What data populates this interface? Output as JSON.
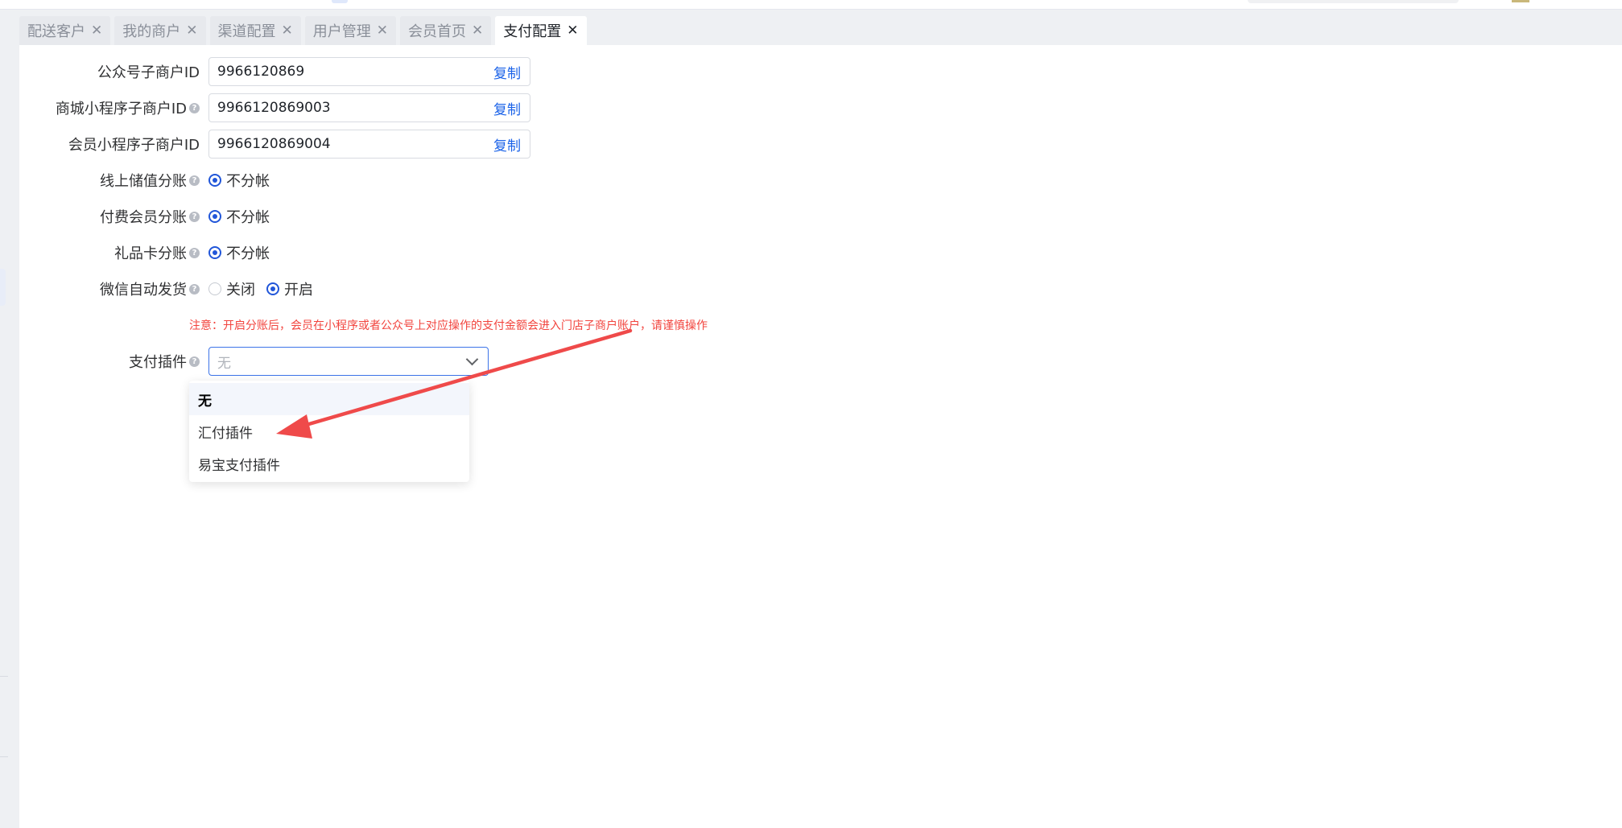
{
  "tabs": [
    {
      "label": "配送客户",
      "close": "✕"
    },
    {
      "label": "我的商户",
      "close": "✕"
    },
    {
      "label": "渠道配置",
      "close": "✕"
    },
    {
      "label": "用户管理",
      "close": "✕"
    },
    {
      "label": "会员首页",
      "close": "✕"
    },
    {
      "label": "支付配置",
      "close": "✕",
      "active": true
    }
  ],
  "form": {
    "official_account_id": {
      "label": "公众号子商户ID",
      "value": "9966120869",
      "copy": "复制"
    },
    "mall_miniprogram_id": {
      "label": "商城小程序子商户ID",
      "value": "9966120869003",
      "copy": "复制"
    },
    "member_miniprogram_id": {
      "label": "会员小程序子商户ID",
      "value": "9966120869004",
      "copy": "复制"
    },
    "online_stored_value_split": {
      "label": "线上储值分账",
      "option": "不分帐"
    },
    "paid_member_split": {
      "label": "付费会员分账",
      "option": "不分帐"
    },
    "gift_card_split": {
      "label": "礼品卡分账",
      "option": "不分帐"
    },
    "wechat_auto_delivery": {
      "label": "微信自动发货",
      "option_off": "关闭",
      "option_on": "开启",
      "selected": "开启"
    },
    "notice": "注意：开启分账后，会员在小程序或者公众号上对应操作的支付金额会进入门店子商户账户，请谨慎操作",
    "payment_plugin": {
      "label": "支付插件",
      "placeholder": "无",
      "options": [
        "无",
        "汇付插件",
        "易宝支付插件"
      ],
      "highlighted": "无"
    }
  },
  "help_icon": "question-circle-icon",
  "colors": {
    "accent": "#2156d9",
    "link": "#1a62e8",
    "notice": "#f2443e",
    "annotation_arrow": "#ef4a4a"
  }
}
